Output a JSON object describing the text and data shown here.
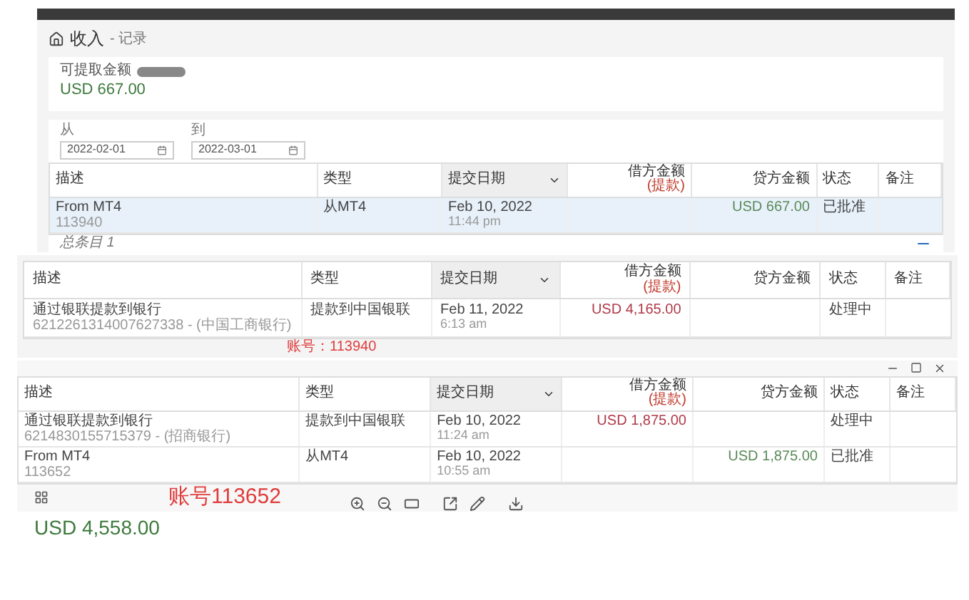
{
  "panel_1": {
    "breadcrumb": {
      "title": "收入",
      "sub": "- 记录"
    },
    "balance": {
      "label": "可提取金额",
      "amount": "USD 667.00"
    },
    "filters": [
      {
        "label": "从",
        "value": "2022-02-01"
      },
      {
        "label": "到",
        "value": "2022-03-01"
      }
    ],
    "table": {
      "columns": [
        {
          "label": "描述",
          "sorted": false
        },
        {
          "label": "类型",
          "sorted": false
        },
        {
          "label": "提交日期",
          "sorted": true
        },
        {
          "label": "借方金额",
          "sub": "(提款)",
          "sorted": false
        },
        {
          "label": "贷方金额",
          "sorted": false
        },
        {
          "label": "状态",
          "sorted": false
        },
        {
          "label": "备注",
          "sorted": false
        }
      ],
      "rows": [
        {
          "description": "From MT4",
          "description_sub": "113940",
          "type": "从MT4",
          "date": "Feb 10, 2022",
          "time": "11:44 pm",
          "credit": "USD 667.00",
          "status": "已批准",
          "selected": true
        }
      ]
    },
    "footer": "总条目 1"
  },
  "panel_2": {
    "table": {
      "columns": [
        {
          "label": "描述",
          "sorted": false
        },
        {
          "label": "类型",
          "sorted": false
        },
        {
          "label": "提交日期",
          "sorted": true
        },
        {
          "label": "借方金额",
          "sub": "(提款)",
          "sorted": false
        },
        {
          "label": "贷方金额",
          "sorted": false
        },
        {
          "label": "状态",
          "sorted": false
        },
        {
          "label": "备注",
          "sorted": false
        }
      ],
      "rows": [
        {
          "description": "通过银联提款到银行",
          "description_sub": "6212261314007627338 - (中国工商银行)",
          "type": "提款到中国银联",
          "date": "Feb 11, 2022",
          "time": "6:13 am",
          "debit": "USD 4,165.00",
          "status": "处理中",
          "selected": false
        }
      ]
    },
    "annotation": "账号：113940"
  },
  "panel_3": {
    "table": {
      "columns": [
        {
          "label": "描述",
          "sorted": false
        },
        {
          "label": "类型",
          "sorted": false
        },
        {
          "label": "提交日期",
          "sorted": true
        },
        {
          "label": "借方金额",
          "sub": "(提款)",
          "sorted": false
        },
        {
          "label": "贷方金额",
          "sorted": false
        },
        {
          "label": "状态",
          "sorted": false
        },
        {
          "label": "备注",
          "sorted": false
        }
      ],
      "rows": [
        {
          "description": "通过银联提款到银行",
          "description_sub": "6214830155715379 - (招商银行)",
          "type": "提款到中国银联",
          "date": "Feb 10, 2022",
          "time": "11:24 am",
          "debit": "USD 1,875.00",
          "status": "处理中",
          "selected": false
        },
        {
          "description": "From MT4",
          "description_sub": "113652",
          "type": "从MT4",
          "date": "Feb 10, 2022",
          "time": "10:55 am",
          "credit": "USD 1,875.00",
          "status": "已批准",
          "selected": false
        }
      ]
    },
    "annotation": "账号113652",
    "amount": "USD 4,558.00"
  }
}
